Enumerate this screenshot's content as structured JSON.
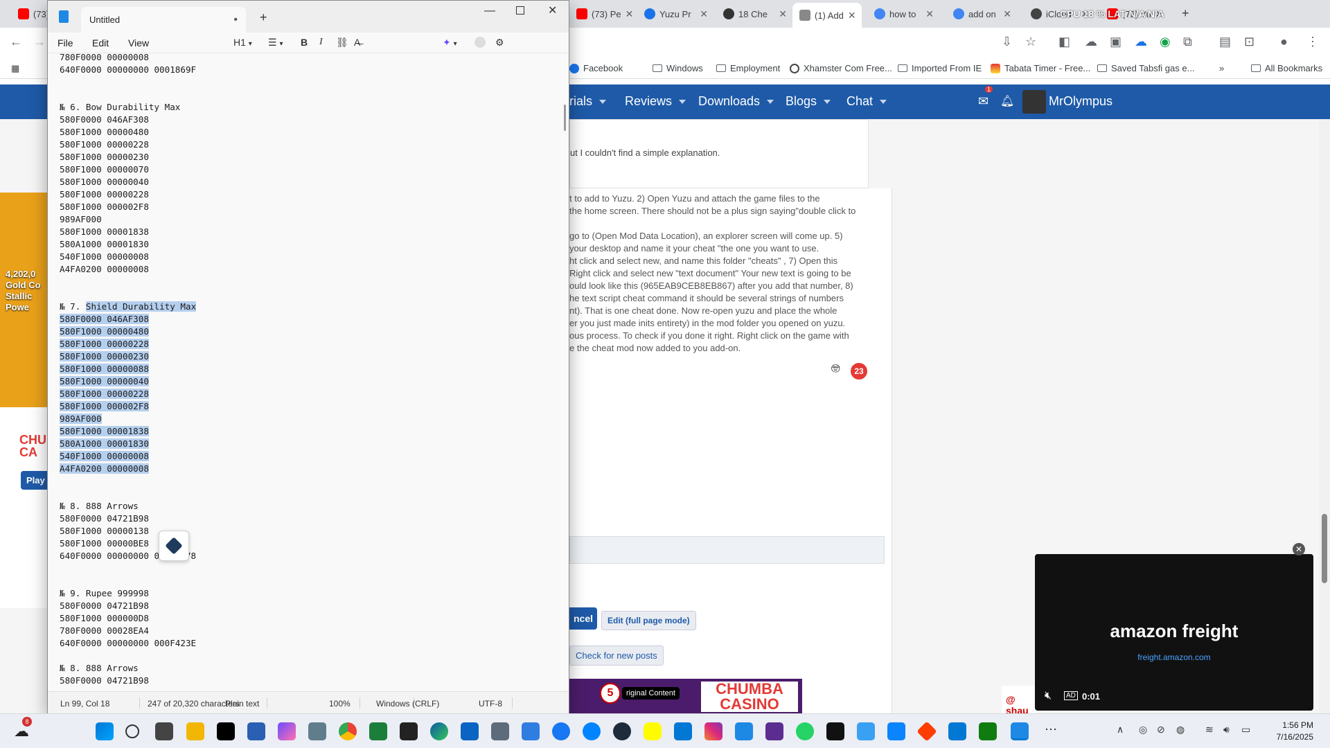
{
  "browser": {
    "tabs": [
      {
        "label": "(73)",
        "color": "#ff0000"
      },
      {
        "label": "(73) Pe",
        "color": "#ff0000"
      },
      {
        "label": "Yuzu Pr",
        "color": "#1a73e8"
      },
      {
        "label": "18 Che",
        "color": "#333333"
      },
      {
        "label": "(1) Add",
        "color": "#555555"
      },
      {
        "label": "how to",
        "color": "#4285f4"
      },
      {
        "label": "add on",
        "color": "#4285f4"
      },
      {
        "label": "iCloud",
        "color": "#444444"
      },
      {
        "label": "(73) Yu",
        "color": "#ff0000"
      }
    ],
    "perf_overlay": "CPU 18 %   LAT N/A N/A",
    "bookmarks": [
      {
        "label": "Facebook"
      },
      {
        "label": "Windows"
      },
      {
        "label": "Employment"
      },
      {
        "label": "Xhamster Com Free..."
      },
      {
        "label": "Imported From IE"
      },
      {
        "label": "Tabata Timer - Free..."
      },
      {
        "label": "Saved Tabsfi  gas e..."
      }
    ],
    "all_bookmarks": "All Bookmarks"
  },
  "site": {
    "nav": [
      {
        "label": "rials"
      },
      {
        "label": "Reviews"
      },
      {
        "label": "Downloads"
      },
      {
        "label": "Blogs"
      },
      {
        "label": "Chat"
      }
    ],
    "username": "MrOlympus",
    "mail_badge": "1",
    "question_tail": "ut I couldn't find a simple explanation.",
    "post_lines": [
      "t to add to Yuzu. 2) Open Yuzu and attach the game files to the",
      "the home screen. There should not be a plus sign saying\"double click to",
      "",
      "go to (Open Mod Data Location), an explorer screen will come up. 5)",
      " your desktop and name it your cheat \"the one you want to use.",
      "ht click and select new, and name this folder \"cheats\" , 7) Open this",
      "Right click and select new \"text document\"  Your new text is going to be",
      "ould look like this (965EAB9CEB8EB867) after you add that number, 8)",
      "he text script cheat command it should be several strings of numbers",
      "nt). That is one cheat done. Now re-open yuzu and place the whole",
      "er you just made inits entirety) in the mod folder you opened on yuzu.",
      "ous process. To check if  you done it right. Right click on the game with",
      "e the cheat mod now added to you add-on."
    ],
    "reaction_count": "23",
    "cancel_button": "ncel",
    "fullpage_button": "Edit (full page mode)",
    "new_posts_button": "Check for new posts",
    "casino_label": "CHUMBA CASINO",
    "original_content_label": "riginal Content",
    "ad_number": "5",
    "video_brand": "amazon freight",
    "video_url": "freight.amazon.com",
    "video_time": "0:01",
    "side_label": "@ shau",
    "left_ad_text": "4,202,0 Gold Co Stallic Powe",
    "left_ad_brand": "CHU CA",
    "left_ad_play": "Play"
  },
  "notepad": {
    "tab_title": "Untitled",
    "menus": [
      "File",
      "Edit",
      "View"
    ],
    "heading_tool": "H1",
    "pre_highlight": "780F0000 00000008\n640F0000 00000000 0001869F\n\n\n№ 6. Bow Durability Max\n580F0000 046AF308\n580F1000 00000480\n580F1000 00000228\n580F1000 00000230\n580F1000 00000070\n580F1000 00000040\n580F1000 00000228\n580F1000 000002F8\n989AF000\n580F1000 00001838\n580A1000 00001830\n540F1000 00000008\nA4FA0200 00000008\n\n\n№ 7. ",
    "highlight": "Shield Durability Max\n580F0000 046AF308\n580F1000 00000480\n580F1000 00000228\n580F1000 00000230\n580F1000 00000088\n580F1000 00000040\n580F1000 00000228\n580F1000 000002F8\n989AF000\n580F1000 00001838\n580A1000 00001830\n540F1000 00000008\nA4FA0200 00000008",
    "post_highlight": "\n\n\n№ 8. 888 Arrows\n580F0000 04721B98\n580F1000 00000138\n580F1000 00000BE8\n640F0000 00000000 00000378\n\n\n№ 9. Rupee 999998\n580F0000 04721B98\n580F1000 000000D8\n780F0000 00028EA4\n640F0000 00000000 000F423E\n\n№ 8. 888 Arrows\n580F0000 04721B98",
    "status": {
      "position": "Ln 99, Col 18",
      "chars": "247 of 20,320 characters",
      "format": "Plain text",
      "zoom": "100%",
      "line_endings": "Windows (CRLF)",
      "encoding": "UTF-8"
    }
  },
  "taskbar": {
    "weather_badge": "8",
    "time": "1:56 PM",
    "date": "7/16/2025"
  }
}
